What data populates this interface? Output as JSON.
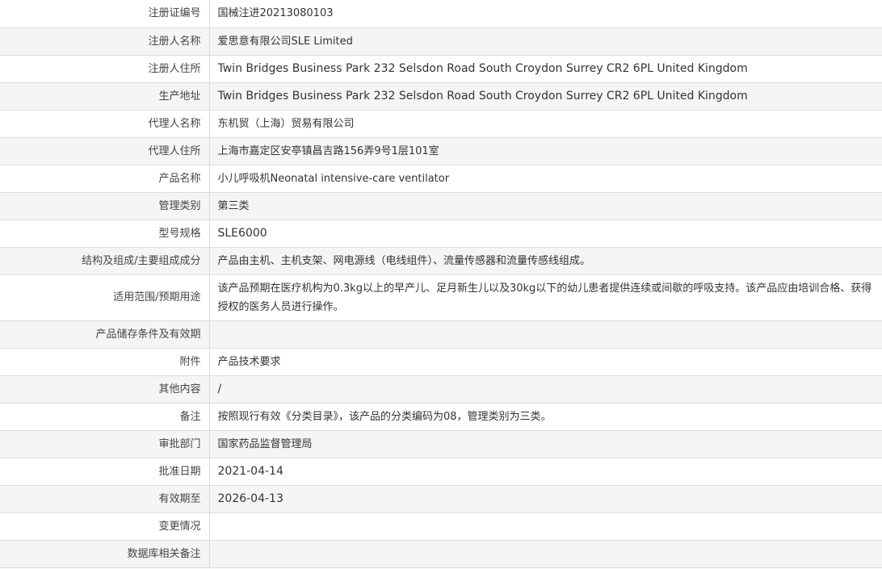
{
  "record": {
    "registration_no": {
      "label": "注册证编号",
      "value": "国械注进20213080103"
    },
    "registrant_name": {
      "label": "注册人名称",
      "value": "爱思意有限公司SLE Limited"
    },
    "registrant_address": {
      "label": "注册人住所",
      "value": "Twin Bridges Business Park 232 Selsdon Road South Croydon Surrey CR2 6PL United Kingdom"
    },
    "production_address": {
      "label": "生产地址",
      "value": "Twin Bridges Business Park 232 Selsdon Road South Croydon Surrey CR2 6PL United Kingdom"
    },
    "agent_name": {
      "label": "代理人名称",
      "value": "东机贸（上海）贸易有限公司"
    },
    "agent_address": {
      "label": "代理人住所",
      "value": "上海市嘉定区安亭镇昌吉路156弄9号1层101室"
    },
    "product_name": {
      "label": "产品名称",
      "value": "小儿呼吸机Neonatal intensive-care ventilator"
    },
    "management_class": {
      "label": "管理类别",
      "value": "第三类"
    },
    "model_spec": {
      "label": "型号规格",
      "value": "SLE6000"
    },
    "structure": {
      "label": "结构及组成/主要组成成分",
      "value": "产品由主机、主机支架、网电源线（电线组件）、流量传感器和流量传感线组成。"
    },
    "intended_use": {
      "label": "适用范围/预期用途",
      "value": "该产品预期在医疗机构为0.3kg以上的早产儿、足月新生儿以及30kg以下的幼儿患者提供连续或间歇的呼吸支持。该产品应由培训合格、获得授权的医务人员进行操作。"
    },
    "storage": {
      "label": "产品储存条件及有效期",
      "value": ""
    },
    "attachment": {
      "label": "附件",
      "value": "产品技术要求"
    },
    "other": {
      "label": "其他内容",
      "value": "/"
    },
    "remarks": {
      "label": "备注",
      "value": "按照现行有效《分类目录》，该产品的分类编码为08，管理类别为三类。"
    },
    "approval_dept": {
      "label": "审批部门",
      "value": "国家药品监督管理局"
    },
    "approval_date": {
      "label": "批准日期",
      "value": "2021-04-14"
    },
    "valid_until": {
      "label": "有效期至",
      "value": "2026-04-13"
    },
    "changes": {
      "label": "变更情况",
      "value": ""
    },
    "db_remarks": {
      "label": "数据库相关备注",
      "value": ""
    }
  }
}
